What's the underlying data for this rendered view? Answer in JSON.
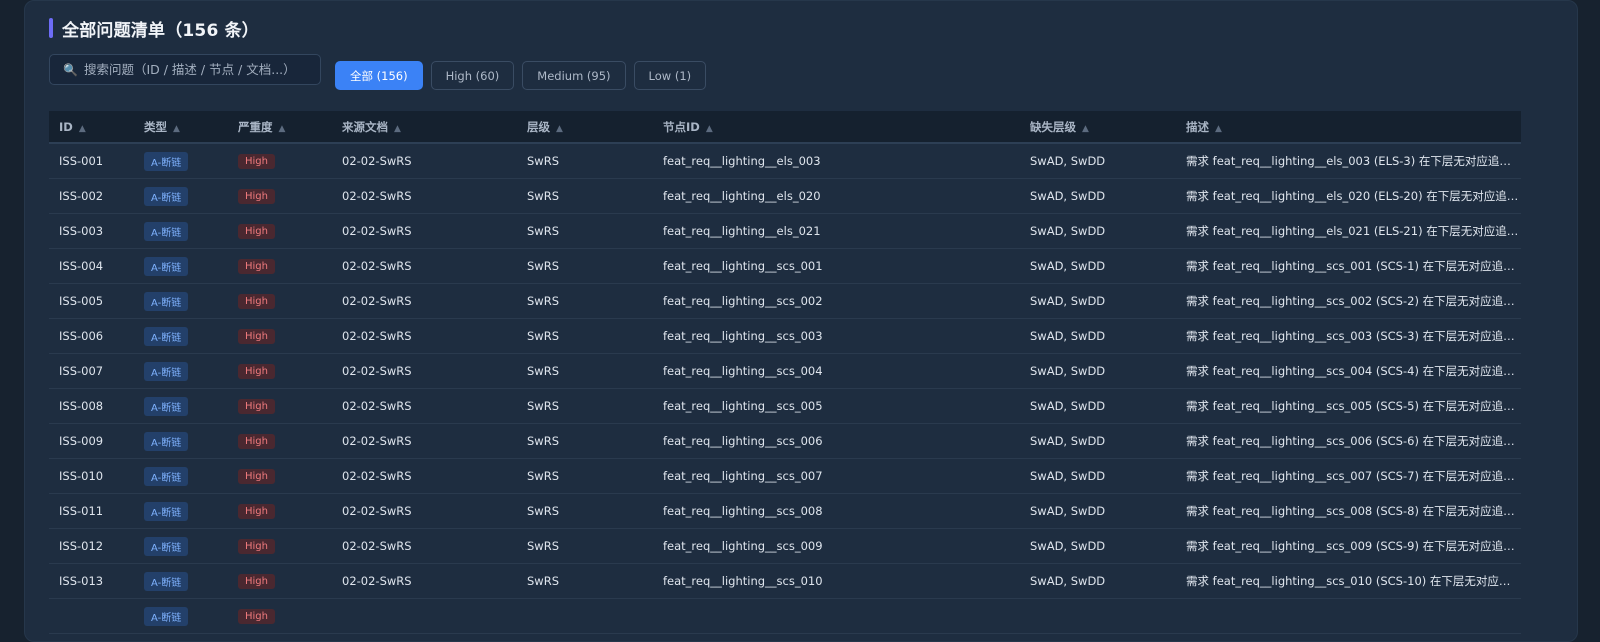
{
  "header": {
    "title": "全部问题清单（156 条）"
  },
  "search": {
    "icon": "search-icon",
    "placeholder": "搜索问题（ID / 描述 / 节点 / 文档...）"
  },
  "filters": [
    {
      "label": "全部 (156)",
      "active": true
    },
    {
      "label": "High (60)",
      "active": false
    },
    {
      "label": "Medium (95)",
      "active": false
    },
    {
      "label": "Low (1)",
      "active": false
    }
  ],
  "table": {
    "columns": [
      "ID",
      "类型",
      "严重度",
      "来源文档",
      "层级",
      "节点ID",
      "缺失层级",
      "描述"
    ],
    "sort_icon": "▲",
    "rows": [
      [
        "ISS-001",
        "A-断链",
        "High",
        "02-02-SwRS",
        "SwRS",
        "feat_req__lighting__els_003",
        "SwAD, SwDD",
        "需求 feat_req__lighting__els_003 (ELS-3) 在下层无对应追溯链，..."
      ],
      [
        "ISS-002",
        "A-断链",
        "High",
        "02-02-SwRS",
        "SwRS",
        "feat_req__lighting__els_020",
        "SwAD, SwDD",
        "需求 feat_req__lighting__els_020 (ELS-20) 在下层无对应追溯链，..."
      ],
      [
        "ISS-003",
        "A-断链",
        "High",
        "02-02-SwRS",
        "SwRS",
        "feat_req__lighting__els_021",
        "SwAD, SwDD",
        "需求 feat_req__lighting__els_021 (ELS-21) 在下层无对应追溯链，..."
      ],
      [
        "ISS-004",
        "A-断链",
        "High",
        "02-02-SwRS",
        "SwRS",
        "feat_req__lighting__scs_001",
        "SwAD, SwDD",
        "需求 feat_req__lighting__scs_001 (SCS-1) 在下层无对应追溯链，..."
      ],
      [
        "ISS-005",
        "A-断链",
        "High",
        "02-02-SwRS",
        "SwRS",
        "feat_req__lighting__scs_002",
        "SwAD, SwDD",
        "需求 feat_req__lighting__scs_002 (SCS-2) 在下层无对应追溯链，..."
      ],
      [
        "ISS-006",
        "A-断链",
        "High",
        "02-02-SwRS",
        "SwRS",
        "feat_req__lighting__scs_003",
        "SwAD, SwDD",
        "需求 feat_req__lighting__scs_003 (SCS-3) 在下层无对应追溯链，..."
      ],
      [
        "ISS-007",
        "A-断链",
        "High",
        "02-02-SwRS",
        "SwRS",
        "feat_req__lighting__scs_004",
        "SwAD, SwDD",
        "需求 feat_req__lighting__scs_004 (SCS-4) 在下层无对应追溯链，..."
      ],
      [
        "ISS-008",
        "A-断链",
        "High",
        "02-02-SwRS",
        "SwRS",
        "feat_req__lighting__scs_005",
        "SwAD, SwDD",
        "需求 feat_req__lighting__scs_005 (SCS-5) 在下层无对应追溯链，..."
      ],
      [
        "ISS-009",
        "A-断链",
        "High",
        "02-02-SwRS",
        "SwRS",
        "feat_req__lighting__scs_006",
        "SwAD, SwDD",
        "需求 feat_req__lighting__scs_006 (SCS-6) 在下层无对应追溯链，..."
      ],
      [
        "ISS-010",
        "A-断链",
        "High",
        "02-02-SwRS",
        "SwRS",
        "feat_req__lighting__scs_007",
        "SwAD, SwDD",
        "需求 feat_req__lighting__scs_007 (SCS-7) 在下层无对应追溯链，..."
      ],
      [
        "ISS-011",
        "A-断链",
        "High",
        "02-02-SwRS",
        "SwRS",
        "feat_req__lighting__scs_008",
        "SwAD, SwDD",
        "需求 feat_req__lighting__scs_008 (SCS-8) 在下层无对应追溯链，..."
      ],
      [
        "ISS-012",
        "A-断链",
        "High",
        "02-02-SwRS",
        "SwRS",
        "feat_req__lighting__scs_009",
        "SwAD, SwDD",
        "需求 feat_req__lighting__scs_009 (SCS-9) 在下层无对应追溯链，..."
      ],
      [
        "ISS-013",
        "A-断链",
        "High",
        "02-02-SwRS",
        "SwRS",
        "feat_req__lighting__scs_010",
        "SwAD, SwDD",
        "需求 feat_req__lighting__scs_010 (SCS-10) 在下层无对应追溯链..."
      ],
      [
        "",
        "A-断链",
        "High",
        "",
        "",
        "",
        "",
        ""
      ]
    ]
  }
}
